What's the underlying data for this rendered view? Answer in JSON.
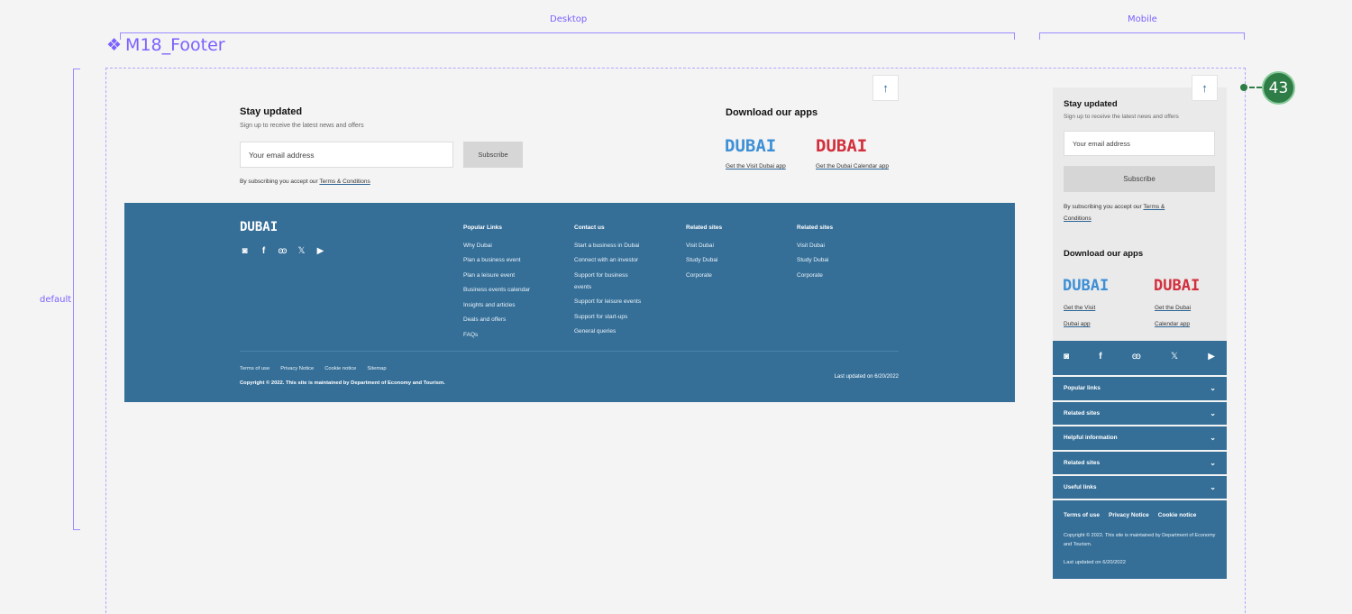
{
  "canvas": {
    "desktop_label": "Desktop",
    "mobile_label": "Mobile",
    "component_name": "M18_Footer",
    "variant_label": "default",
    "badge_count": "43",
    "colors": {
      "annotation": "#7b61ff",
      "footer_bg": "#356f98",
      "badge": "#2f7d46"
    }
  },
  "desktop": {
    "back_to_top": "↑",
    "newsletter": {
      "title": "Stay updated",
      "subtitle": "Sign up to receive the latest news and offers",
      "email_placeholder": "Your email address",
      "subscribe_label": "Subscribe",
      "accept_prefix": "By subscribing you accept our",
      "terms_link": "Terms & Conditions"
    },
    "apps": {
      "title": "Download our apps",
      "visit_logo": "DUBAI",
      "visit_link": "Get the Visit Dubai app",
      "calendar_logo": "DUBAI",
      "calendar_link": "Get the Dubai Calendar app"
    },
    "footer": {
      "logo": "DUBAI",
      "social_icons": [
        "instagram-icon",
        "facebook-icon",
        "tripadvisor-icon",
        "x-icon",
        "youtube-icon"
      ],
      "columns": [
        {
          "heading": "Popular Links",
          "items": [
            "Why Dubai",
            "Plan a business event",
            "Plan a leisure event",
            "Business events calendar",
            "Insights and articles",
            "Deals and offers",
            "FAQs"
          ]
        },
        {
          "heading": "Contact us",
          "items": [
            "Start a business in Dubai",
            "Connect with an investor",
            "Support for business events",
            "Support for leisure events",
            "Support for start-ups",
            "General queries"
          ]
        },
        {
          "heading": "Related sites",
          "items": [
            "Visit Dubai",
            "Study Dubai",
            "Corporate"
          ]
        },
        {
          "heading": "Related sites",
          "items": [
            "Visit Dubai",
            "Study Dubai",
            "Corporate"
          ]
        }
      ],
      "legal_links": [
        "Terms of use",
        "Privacy Notice",
        "Cookie notice",
        "Sitemap"
      ],
      "copyright": "Copyright © 2022. This site is maintained by Department of Economy and Tourism.",
      "last_updated": "Last updated on 6/20/2022"
    }
  },
  "mobile": {
    "back_to_top": "↑",
    "newsletter": {
      "title": "Stay updated",
      "subtitle": "Sign up to receive the latest news and offers",
      "email_placeholder": "Your email address",
      "subscribe_label": "Subscribe",
      "accept_prefix": "By subscribing you accept our",
      "terms_link_1": "Terms &",
      "terms_link_2": "Conditions"
    },
    "apps": {
      "title": "Download our apps",
      "visit_logo": "DUBAI",
      "visit_link_1": "Get the Visit",
      "visit_link_2": "Dubai app",
      "calendar_logo": "DUBAI",
      "calendar_link_1": "Get the Dubai",
      "calendar_link_2": "Calendar app"
    },
    "footer": {
      "accordions": [
        "Popular links",
        "Related sites",
        "Helpful information",
        "Related sites",
        "Useful links"
      ],
      "legal_links": [
        "Terms of use",
        "Privacy Notice",
        "Cookie notice"
      ],
      "copyright": "Copyright © 2022. This site is maintained by Department of Economy and Tourism.",
      "last_updated": "Last updated on 6/20/2022"
    }
  }
}
